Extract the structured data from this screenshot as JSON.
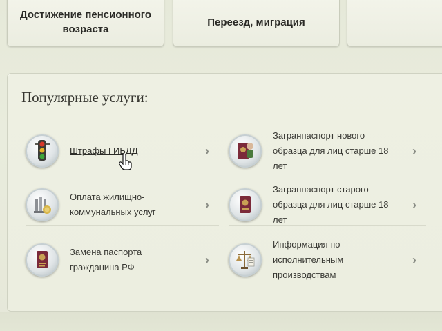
{
  "top_tiles": [
    {
      "label_line1": "Достижение пенсионного",
      "label_line2": "возраста"
    },
    {
      "label_line1": "Переезд, миграция",
      "label_line2": ""
    },
    {
      "label_line1": "",
      "label_line2": ""
    }
  ],
  "popular": {
    "title": "Популярные услуги:",
    "items": [
      {
        "line1": "Штрафы ГИБДД",
        "line2": "",
        "line3": "",
        "icon": "traffic-light-icon",
        "chevron": "›"
      },
      {
        "line1": "Загранпаспорт нового",
        "line2": "образца для лиц старше 18",
        "line3": "лет",
        "icon": "passport-new-icon",
        "chevron": "›"
      },
      {
        "line1": "Оплата жилищно-",
        "line2": "коммунальных услуг",
        "line3": "",
        "icon": "utilities-icon",
        "chevron": "›"
      },
      {
        "line1": "Загранпаспорт старого",
        "line2": "образца для лиц старше 18",
        "line3": "лет",
        "icon": "passport-old-icon",
        "chevron": "›"
      },
      {
        "line1": "Замена паспорта",
        "line2": "гражданина РФ",
        "line3": "",
        "icon": "passport-rf-icon",
        "chevron": "›"
      },
      {
        "line1": "Информация по",
        "line2": "исполнительным",
        "line3": "производствам",
        "icon": "scales-icon",
        "chevron": "›"
      }
    ]
  },
  "colors": {
    "background": "#e6e9d9",
    "text": "#3a3a35",
    "passport": "#7b2a3a"
  }
}
